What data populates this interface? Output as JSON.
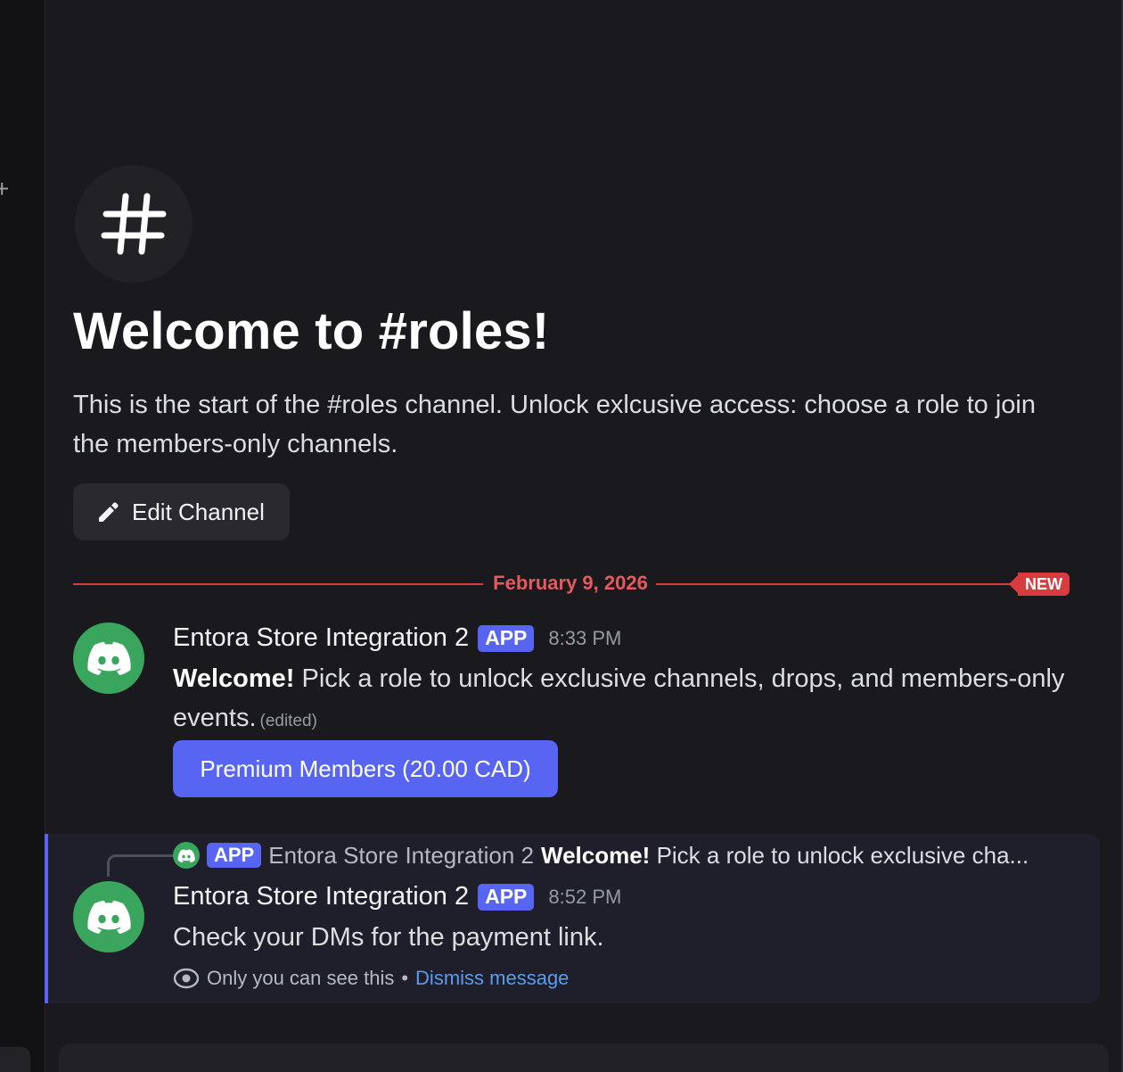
{
  "channel": {
    "welcome_title": "Welcome to #roles!",
    "description": "This is the start of the #roles channel. Unlock exlcusive access: choose a role to join the members-only channels.",
    "edit_button_label": "Edit Channel"
  },
  "date_divider": {
    "date": "February 9, 2026",
    "new_badge": "NEW"
  },
  "messages": [
    {
      "author": "Entora Store Integration 2",
      "tag": "APP",
      "time": "8:33 PM",
      "bold_text": "Welcome!",
      "text": " Pick a role to unlock exclusive channels, drops, and members-only events.",
      "edited_label": "(edited)",
      "button_label": "Premium Members (20.00 CAD)"
    },
    {
      "reply": {
        "tag": "APP",
        "author": "Entora Store Integration 2",
        "bold_text": "Welcome!",
        "snippet": " Pick a role to unlock exclusive cha..."
      },
      "author": "Entora Store Integration 2",
      "tag": "APP",
      "time": "8:52 PM",
      "text": "Check your DMs for the payment link.",
      "ephemeral_note": "Only you can see this",
      "separator": "•",
      "dismiss_label": "Dismiss message"
    }
  ],
  "colors": {
    "accent": "#5865f2",
    "new_red": "#d83c3e",
    "avatar_green": "#3aa55d",
    "link_blue": "#5a9cf0"
  },
  "icons": {
    "channel": "hash-icon",
    "edit": "pencil-icon",
    "avatar": "discord-logo-icon",
    "ephemeral": "eye-icon",
    "rail": "plus-icon"
  }
}
